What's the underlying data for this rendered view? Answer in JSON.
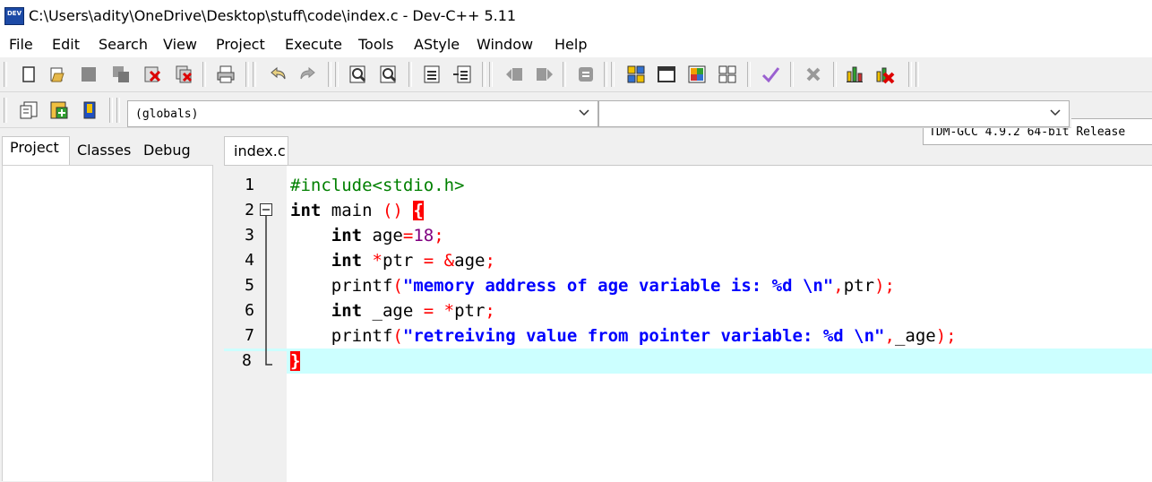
{
  "window": {
    "title": "C:\\Users\\adity\\OneDrive\\Desktop\\stuff\\code\\index.c - Dev-C++ 5.11",
    "app_icon_text": "DEV"
  },
  "menu": [
    "File",
    "Edit",
    "Search",
    "View",
    "Project",
    "Execute",
    "Tools",
    "AStyle",
    "Window",
    "Help"
  ],
  "toolbar": {
    "compiler": "TDM-GCC 4.9.2 64-bit Release"
  },
  "scope_bar": {
    "globals": "(globals)",
    "members": ""
  },
  "left_panel": {
    "tabs": [
      "Project",
      "Classes",
      "Debug"
    ],
    "active_tab": "Project"
  },
  "editor": {
    "tab_label": "index.c",
    "current_line": 8,
    "lines": [
      {
        "n": "1"
      },
      {
        "n": "2",
        "fold": "minus"
      },
      {
        "n": "3"
      },
      {
        "n": "4"
      },
      {
        "n": "5"
      },
      {
        "n": "6"
      },
      {
        "n": "7"
      },
      {
        "n": "8",
        "fold": "end"
      }
    ],
    "tokens": {
      "l1": [
        "#include<stdio.h>"
      ],
      "l2": [
        "int",
        " main ",
        "()",
        " ",
        "{"
      ],
      "l3": [
        "    ",
        "int",
        " age",
        "=",
        "18",
        ";"
      ],
      "l4": [
        "    ",
        "int",
        " ",
        "*",
        "ptr ",
        "=",
        " ",
        "&",
        "age",
        ";"
      ],
      "l5": [
        "    printf",
        "(",
        "\"memory address of age variable is: %d \\n\"",
        ",",
        "ptr",
        ")",
        ";"
      ],
      "l6": [
        "    ",
        "int",
        " _age ",
        "=",
        " ",
        "*",
        "ptr",
        ";"
      ],
      "l7": [
        "    printf",
        "(",
        "\"retreiving value from pointer variable: %d \\n\"",
        ",",
        "_age",
        ")",
        ";"
      ],
      "l8": [
        "}"
      ]
    }
  },
  "colors": {
    "keyword": "#000000",
    "preprocessor": "#008000",
    "number": "#800080",
    "symbol": "#ff0000",
    "string": "#0000ff",
    "current_line": "#ccffff",
    "brace_match": "#ff0000"
  }
}
